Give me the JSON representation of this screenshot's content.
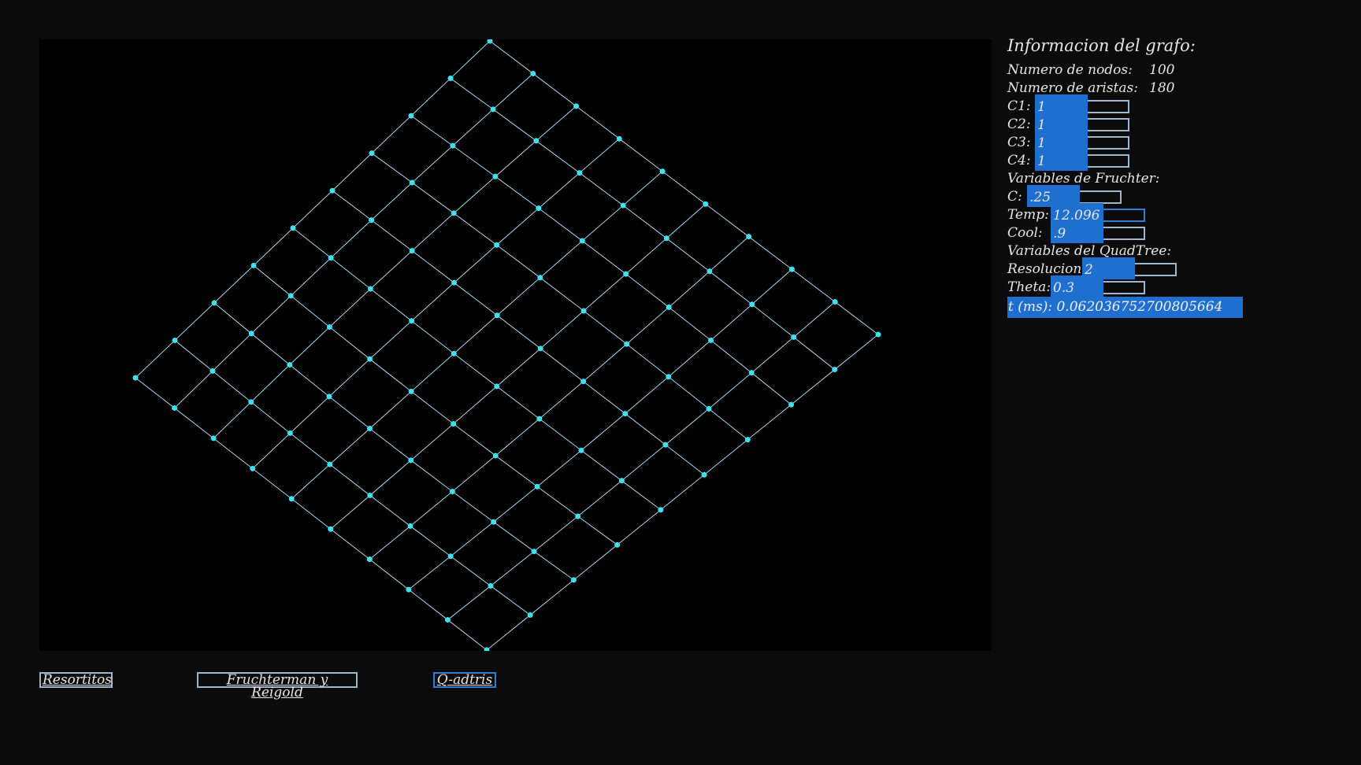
{
  "panel": {
    "title": "Informacion del grafo:",
    "nodes_label": "Numero de nodos:",
    "nodes_value": "100",
    "edges_label": "Numero de aristas:",
    "edges_value": "180",
    "c1_label": "C1:",
    "c1_value": "1",
    "c1_level": 0.58,
    "c2_label": "C2:",
    "c2_value": "1",
    "c2_level": 0.58,
    "c3_label": "C3:",
    "c3_value": "1",
    "c3_level": 0.58,
    "c4_label": "C4:",
    "c4_value": "1",
    "c4_level": 0.58,
    "fruchter_heading": "Variables de Fruchter:",
    "c_label": "C:",
    "c_value": ".25",
    "c_level": 0.58,
    "temp_label": "Temp:",
    "temp_value": "12.096",
    "temp_level": 0.58,
    "cool_label": "Cool:",
    "cool_value": ".9",
    "cool_level": 0.58,
    "quadtree_heading": "Variables del QuadTree:",
    "res_label": "Resolucion:",
    "res_value": "2",
    "res_level": 0.58,
    "theta_label": "Theta:",
    "theta_value": "0.3",
    "theta_level": 0.58,
    "time_text": "t (ms): 0.062036752700805664"
  },
  "buttons": {
    "resortitos": "Resortitos",
    "fruchterman": "Fruchterman y Reigold",
    "qadtris": "Q-adtris"
  },
  "graph": {
    "nodes": 100,
    "edges": 180,
    "node_color": "#3fe0f0",
    "edge_color": "#a9d8ef"
  },
  "colors": {
    "background": "#0b0b0b",
    "canvas": "#000000",
    "accent": "#1f6fcf",
    "border": "#9fb6cf"
  }
}
